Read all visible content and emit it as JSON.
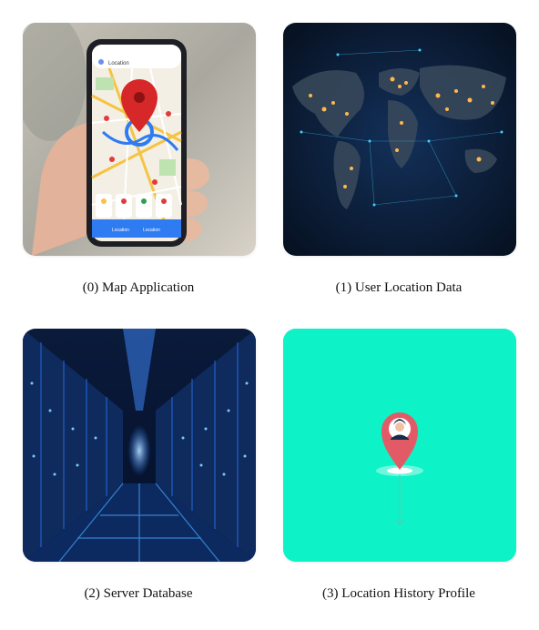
{
  "items": [
    {
      "caption": "(0) Map Application",
      "icon": "map-app-phone-icon"
    },
    {
      "caption": "(1) User Location Data",
      "icon": "world-map-lights-icon"
    },
    {
      "caption": "(2) Server Database",
      "icon": "server-room-icon"
    },
    {
      "caption": "(3) Location History Profile",
      "icon": "location-pin-profile-icon"
    }
  ],
  "phone": {
    "search_label": "Location",
    "tab_left": "Location",
    "tab_right": "Location"
  },
  "colors": {
    "teal_bg": "#0ef2c8",
    "pin_red": "#e23b3b",
    "night_bg": "#0a1a33",
    "server_blue": "#2a7bff"
  }
}
